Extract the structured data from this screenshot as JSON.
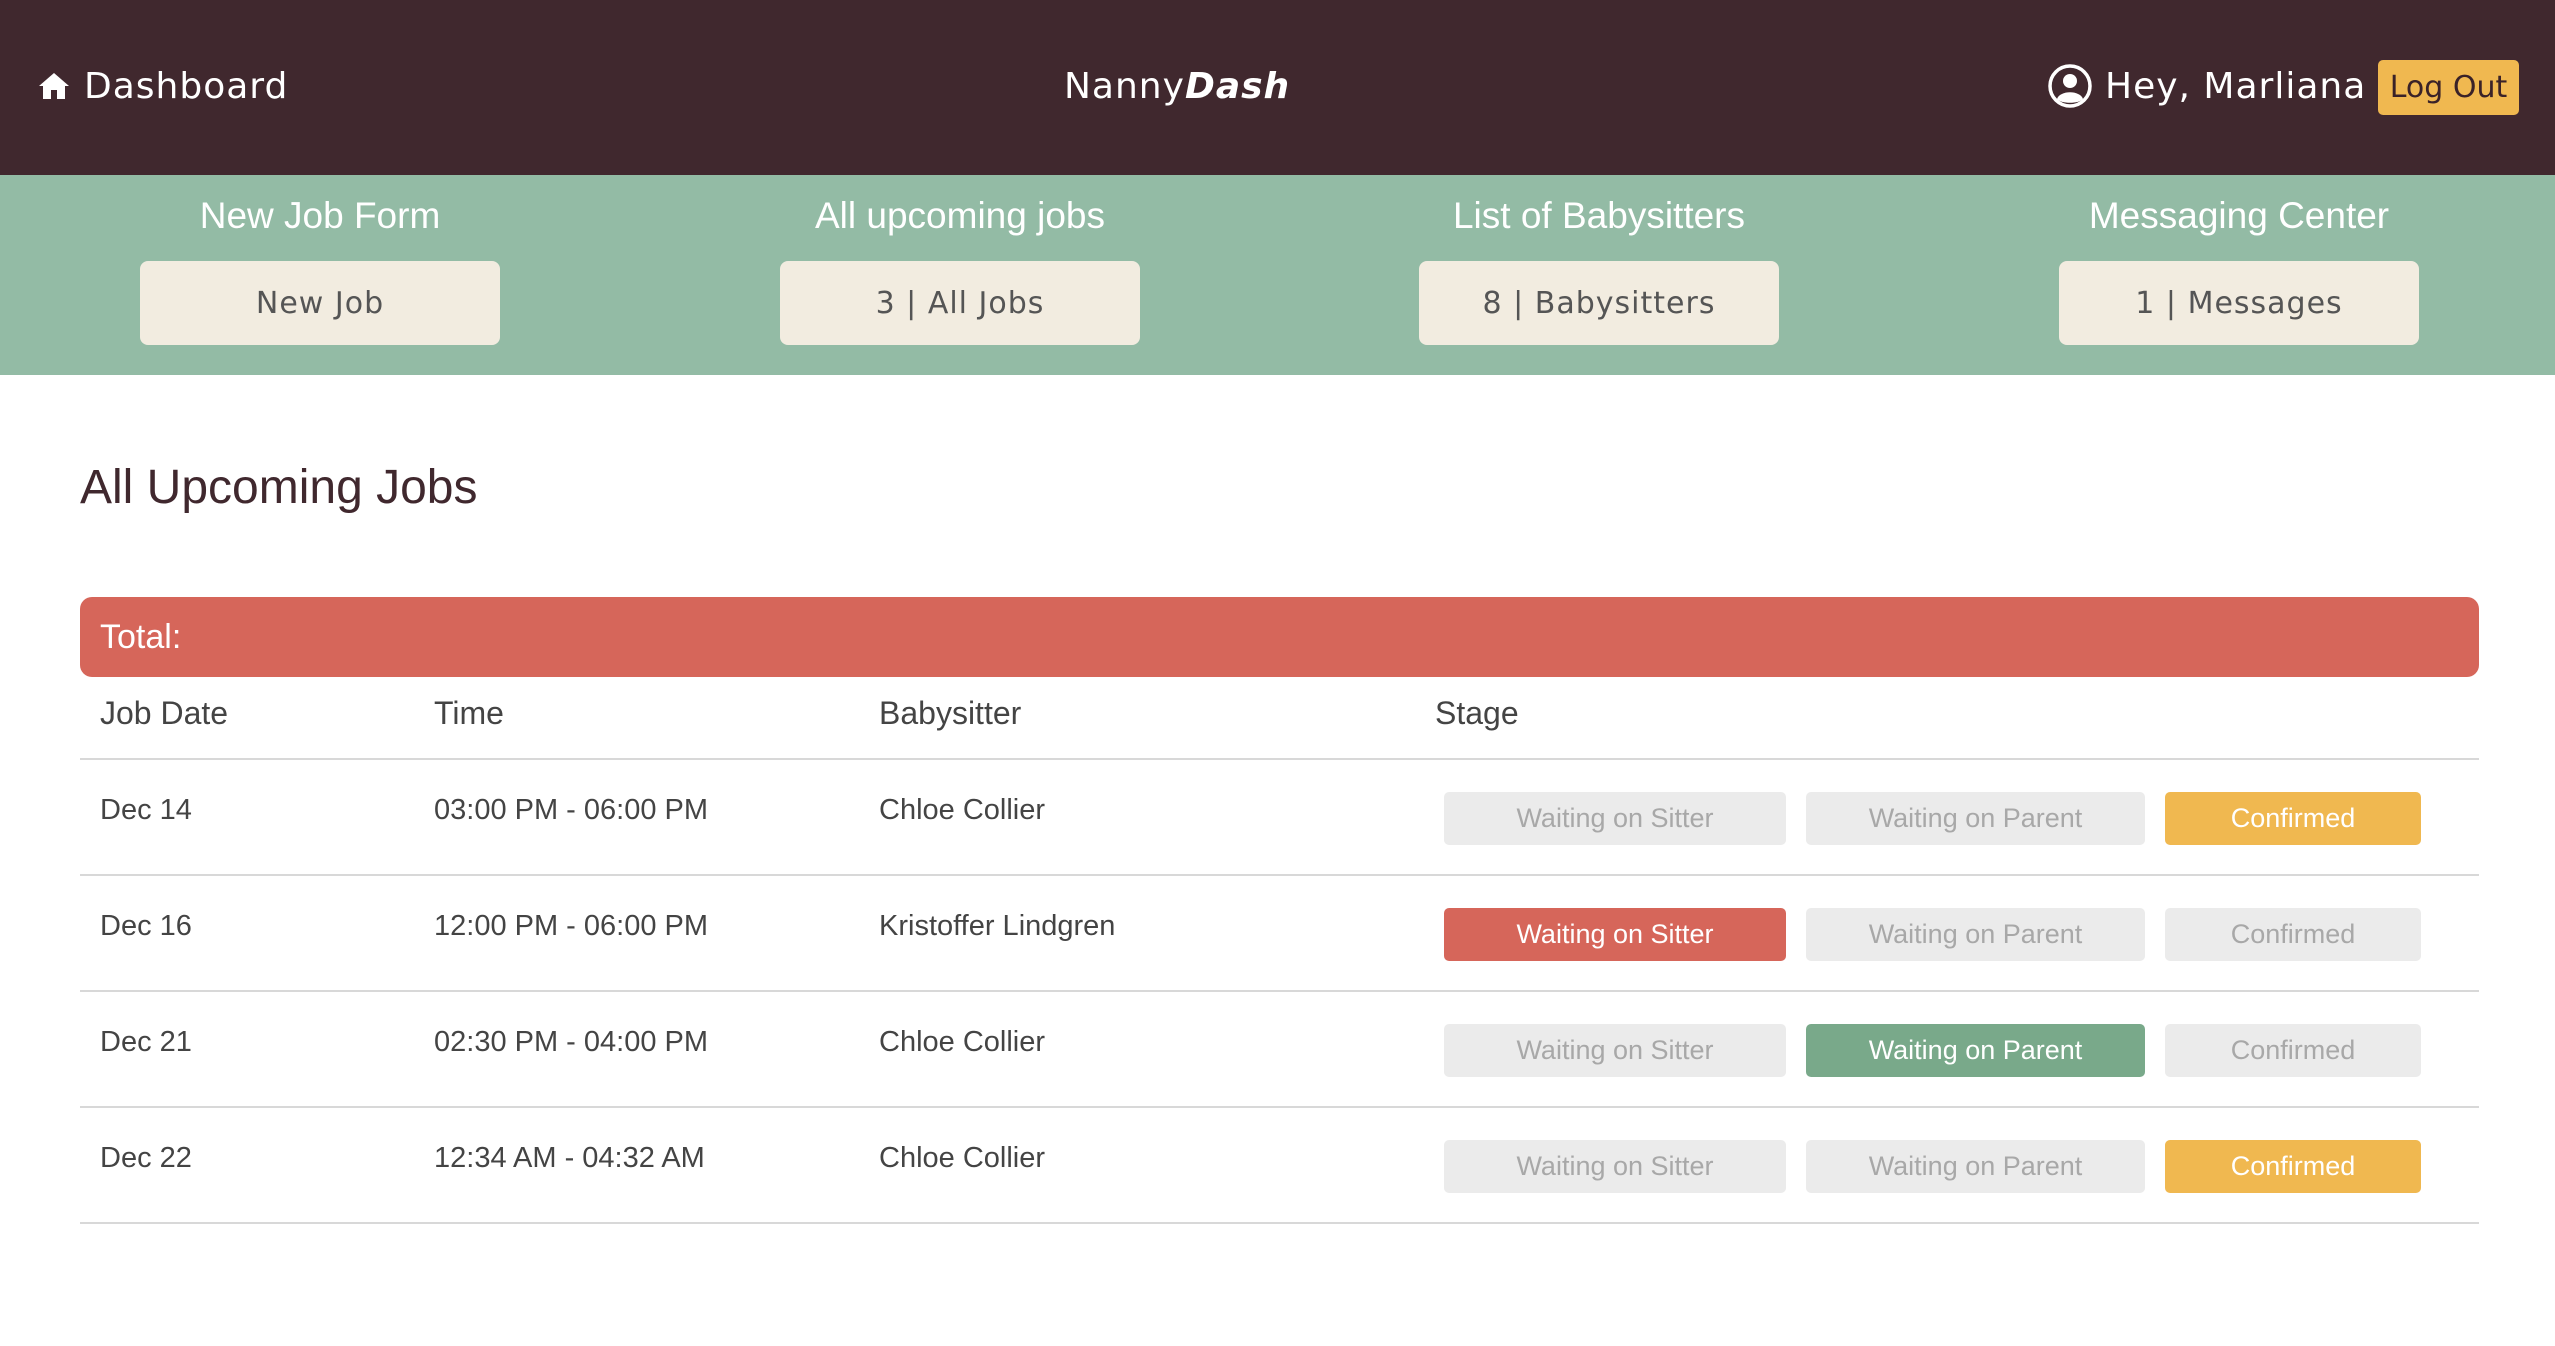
{
  "colors": {
    "topbar": "#40282e",
    "strip": "#93bba5",
    "accent_red": "#d6665a",
    "accent_green": "#79a98a",
    "accent_yellow": "#f0b850",
    "stage_inactive": "#ebebeb"
  },
  "header": {
    "home_icon": "home-icon",
    "home_label": "Dashboard",
    "title_plain": "Nanny",
    "title_italic": "Dash",
    "user_icon": "user-circle-icon",
    "greeting": "Hey, Marliana",
    "logout_label": "Log Out"
  },
  "quick_links": [
    {
      "heading": "New Job Form",
      "button": "New Job"
    },
    {
      "heading": "All upcoming jobs",
      "button": "3 | All Jobs"
    },
    {
      "heading": "List of Babysitters",
      "button": "8 | Babysitters"
    },
    {
      "heading": "Messaging Center",
      "button": "1 | Messages"
    }
  ],
  "main": {
    "title": "All Upcoming Jobs",
    "total_label": "Total:",
    "columns": [
      "Job Date",
      "Time",
      "Babysitter",
      "Stage"
    ],
    "stage_labels": [
      "Waiting on Sitter",
      "Waiting on Parent",
      "Confirmed"
    ],
    "jobs": [
      {
        "date": "Dec 14",
        "time": "03:00 PM - 06:00 PM",
        "sitter": "Chloe Collier",
        "active_stage": "Confirmed"
      },
      {
        "date": "Dec 16",
        "time": "12:00 PM - 06:00 PM",
        "sitter": "Kristoffer Lindgren",
        "active_stage": "Waiting on Sitter"
      },
      {
        "date": "Dec 21",
        "time": "02:30 PM - 04:00 PM",
        "sitter": "Chloe Collier",
        "active_stage": "Waiting on Parent"
      },
      {
        "date": "Dec 22",
        "time": "12:34 AM - 04:32 AM",
        "sitter": "Chloe Collier",
        "active_stage": "Confirmed"
      }
    ]
  }
}
